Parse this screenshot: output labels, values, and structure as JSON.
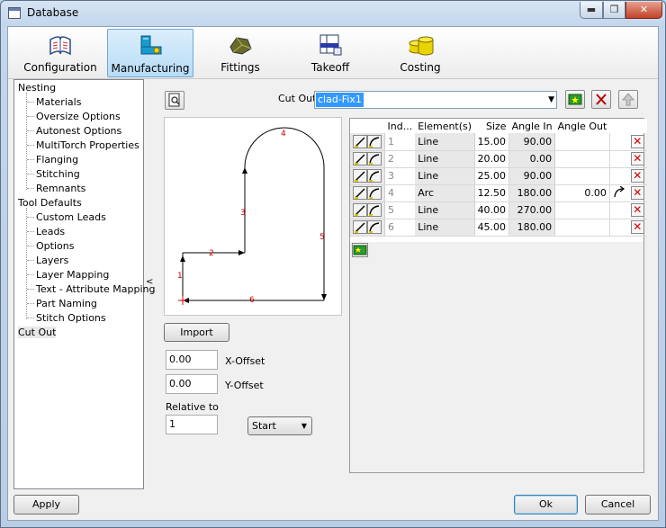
{
  "window": {
    "title": "Database",
    "min_glyph": "▬",
    "restore_glyph": "❐",
    "close_glyph": "✕"
  },
  "toolbar": {
    "tabs": [
      {
        "label": "Configuration",
        "icon": "book-icon"
      },
      {
        "label": "Manufacturing",
        "icon": "machine-icon",
        "active": true
      },
      {
        "label": "Fittings",
        "icon": "fitting-icon"
      },
      {
        "label": "Takeoff",
        "icon": "takeoff-icon"
      },
      {
        "label": "Costing",
        "icon": "coins-icon"
      }
    ]
  },
  "tree": {
    "items": [
      {
        "label": "Nesting",
        "level": 0
      },
      {
        "label": "Materials",
        "level": 1
      },
      {
        "label": "Oversize Options",
        "level": 1
      },
      {
        "label": "Autonest Options",
        "level": 1
      },
      {
        "label": "MultiTorch Properties",
        "level": 1
      },
      {
        "label": "Flanging",
        "level": 1
      },
      {
        "label": "Stitching",
        "level": 1
      },
      {
        "label": "Remnants",
        "level": 1
      },
      {
        "label": "Tool Defaults",
        "level": 0
      },
      {
        "label": "Custom Leads",
        "level": 1
      },
      {
        "label": "Leads",
        "level": 1
      },
      {
        "label": "Options",
        "level": 1
      },
      {
        "label": "Layers",
        "level": 1
      },
      {
        "label": "Layer Mapping",
        "level": 1
      },
      {
        "label": "Text - Attribute Mapping",
        "level": 1
      },
      {
        "label": "Part Naming",
        "level": 1
      },
      {
        "label": "Stitch Options",
        "level": 1
      },
      {
        "label": "Cut Out",
        "level": 0,
        "selected": true
      }
    ],
    "collapse_glyph": "<"
  },
  "cutout": {
    "label": "Cut Out",
    "value": "clad-Fix1",
    "dropdown_glyph": "▼"
  },
  "grid": {
    "headers": [
      "Ind...",
      "Element(s)",
      "Size",
      "Angle In",
      "Angle Out"
    ],
    "rows": [
      {
        "index": "1",
        "element": "Line",
        "size": "15.00",
        "angle_in": "90.00",
        "angle_out": ""
      },
      {
        "index": "2",
        "element": "Line",
        "size": "20.00",
        "angle_in": "0.00",
        "angle_out": ""
      },
      {
        "index": "3",
        "element": "Line",
        "size": "25.00",
        "angle_in": "90.00",
        "angle_out": ""
      },
      {
        "index": "4",
        "element": "Arc",
        "size": "12.50",
        "angle_in": "180.00",
        "angle_out": "0.00"
      },
      {
        "index": "5",
        "element": "Line",
        "size": "40.00",
        "angle_in": "270.00",
        "angle_out": ""
      },
      {
        "index": "6",
        "element": "Line",
        "size": "45.00",
        "angle_in": "180.00",
        "angle_out": ""
      }
    ],
    "delete_glyph": "✕"
  },
  "preview": {
    "segment_labels": [
      "1",
      "2",
      "3",
      "4",
      "5",
      "6"
    ]
  },
  "import_label": "Import",
  "x_offset": {
    "label": "X-Offset",
    "value": "0.00"
  },
  "y_offset": {
    "label": "Y-Offset",
    "value": "0.00"
  },
  "relative": {
    "label": "Relative to",
    "value": "1"
  },
  "start_select": {
    "value": "Start",
    "arrow": "▼"
  },
  "apply_label": "Apply",
  "ok_label": "Ok",
  "cancel_label": "Cancel",
  "colors": {
    "accent": "#3399ff",
    "delete": "#d20000",
    "preview_line": "#000000",
    "preview_label": "#d00000"
  }
}
